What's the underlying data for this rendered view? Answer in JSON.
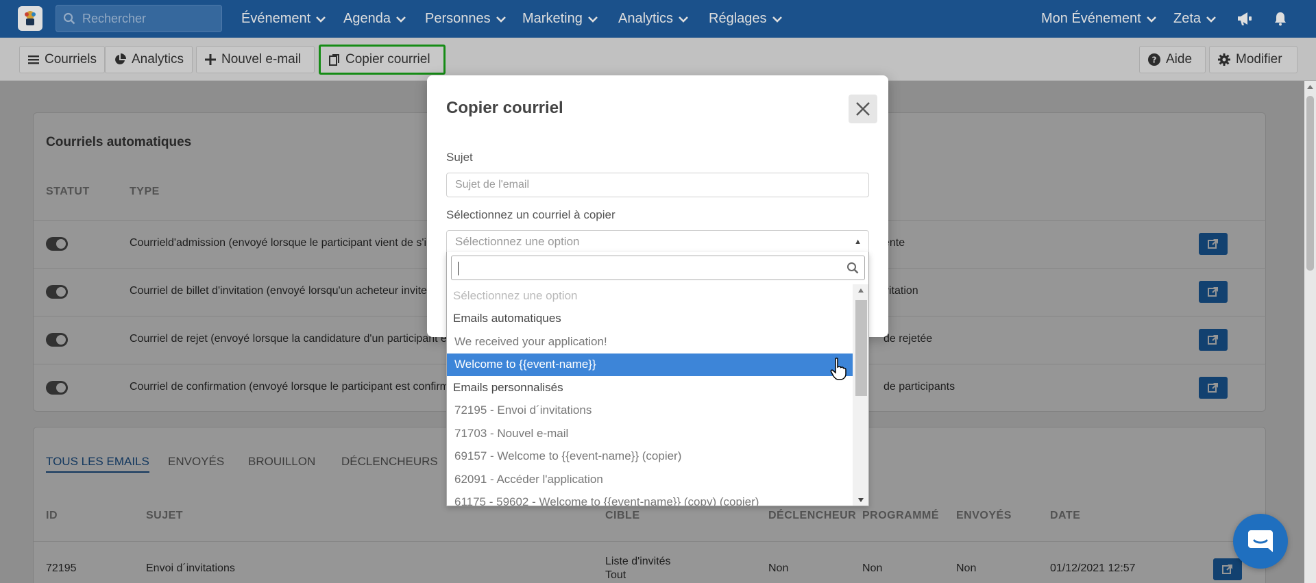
{
  "nav": {
    "search_placeholder": "Rechercher",
    "items": [
      "Événement",
      "Agenda",
      "Personnes",
      "Marketing",
      "Analytics",
      "Réglages"
    ],
    "event_menu": "Mon Événement",
    "user_menu": "Zeta"
  },
  "toolbar": {
    "courriels": "Courriels",
    "analytics": "Analytics",
    "new_email": "Nouvel e-mail",
    "copy_email": "Copier courriel",
    "help": "Aide",
    "edit": "Modifier"
  },
  "auto_card": {
    "title": "Courriels automatiques",
    "col_status": "STATUT",
    "col_type": "TYPE",
    "rows": [
      {
        "type": "Courrield'admission (envoyé lorsque le participant vient de s'in",
        "target": "ente"
      },
      {
        "type": "Courriel de billet d'invitation (envoyé lorsqu'un acheteur invite",
        "target": "vitation"
      },
      {
        "type": "Courriel de rejet (envoyé lorsque la candidature d'un participant e",
        "target": "de rejetée"
      },
      {
        "type": "Courriel de confirmation (envoyé lorsque le participant est confirm",
        "target": "de participants"
      }
    ]
  },
  "emails_card": {
    "tabs": [
      "TOUS LES EMAILS",
      "ENVOYÉS",
      "BROUILLON",
      "DÉCLENCHEURS"
    ],
    "columns": [
      "ID",
      "SUJET",
      "CIBLE",
      "DÉCLENCHEUR",
      "PROGRAMMÉ",
      "ENVOYÉS",
      "DATE"
    ],
    "rows": [
      {
        "id": "72195",
        "subject": "Envoi d´invitations",
        "target_1": "Liste d'invités",
        "target_2": "Tout",
        "trigger": "Non",
        "scheduled": "Non",
        "sent": "Non",
        "date": "01/12/2021 12:57"
      }
    ]
  },
  "modal": {
    "title": "Copier courriel",
    "subject_label": "Sujet",
    "subject_placeholder": "Sujet de l'email",
    "select_label": "Sélectionnez un courriel à copier",
    "select_placeholder": "Sélectionnez une option"
  },
  "dropdown": {
    "options": [
      {
        "text": "Sélectionnez une option",
        "kind": "placeholder"
      },
      {
        "text": "Emails automatiques",
        "kind": "group"
      },
      {
        "text": "We received your application!",
        "kind": "option"
      },
      {
        "text": "Welcome to {{event-name}}",
        "kind": "selected"
      },
      {
        "text": "Emails personnalisés",
        "kind": "group"
      },
      {
        "text": "72195 - Envoi d´invitations",
        "kind": "option"
      },
      {
        "text": "71703 - Nouvel e-mail",
        "kind": "option"
      },
      {
        "text": "69157 - Welcome to {{event-name}} (copier)",
        "kind": "option"
      },
      {
        "text": "62091 - Accéder l'application",
        "kind": "option"
      },
      {
        "text": "61175 - 59602 - Welcome to {{event-name}} (copy) (copier)",
        "kind": "option"
      }
    ]
  },
  "colors": {
    "nav_bg": "#1f5da0",
    "highlight_border": "#1aa11a",
    "selected_option": "#3d85d8",
    "edit_button": "#1f6fbf"
  }
}
